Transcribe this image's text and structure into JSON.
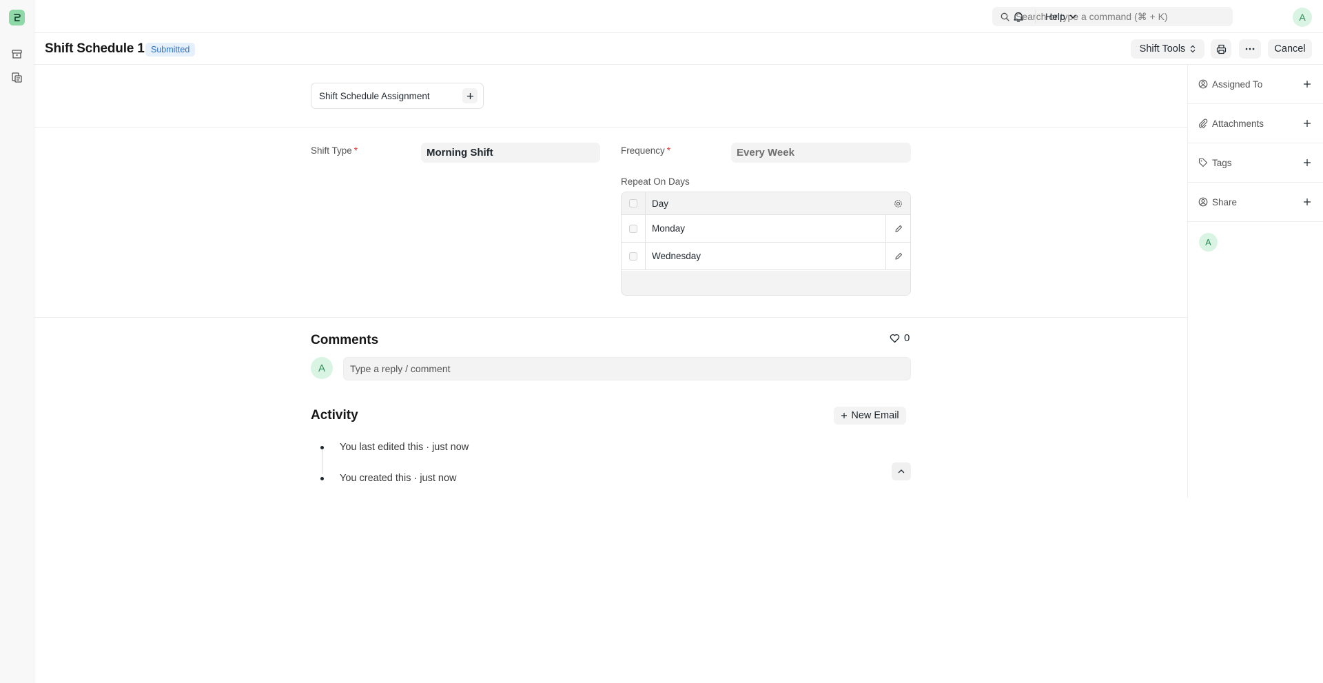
{
  "app": {
    "search_placeholder": "Search or type a command (⌘ + K)",
    "help_label": "Help",
    "user_initial": "A"
  },
  "header": {
    "title": "Shift Schedule 1",
    "status": "Submitted",
    "tools_label": "Shift Tools",
    "cancel_label": "Cancel"
  },
  "connections": {
    "card_label": "Shift Schedule Assignment"
  },
  "form": {
    "shift_type_label": "Shift Type",
    "shift_type_value": "Morning Shift",
    "frequency_label": "Frequency",
    "frequency_value": "Every Week",
    "repeat_label": "Repeat On Days",
    "required_mark": "*",
    "grid": {
      "column": "Day",
      "rows": [
        "Monday",
        "Wednesday"
      ]
    }
  },
  "comments": {
    "title": "Comments",
    "likes": "0",
    "avatar_initial": "A",
    "placeholder": "Type a reply / comment"
  },
  "activity": {
    "title": "Activity",
    "new_email_label": "New Email",
    "items": [
      "You last edited this · just now",
      "You created this · just now"
    ]
  },
  "sidebar": {
    "items": [
      {
        "label": "Assigned To",
        "icon": "assign-icon"
      },
      {
        "label": "Attachments",
        "icon": "paperclip-icon"
      },
      {
        "label": "Tags",
        "icon": "tag-icon"
      },
      {
        "label": "Share",
        "icon": "share-icon"
      }
    ],
    "viewer_initial": "A"
  },
  "colors": {
    "accent_green": "#8fd8a8",
    "status_blue": "#2d6fc2",
    "required_red": "#e03636"
  }
}
